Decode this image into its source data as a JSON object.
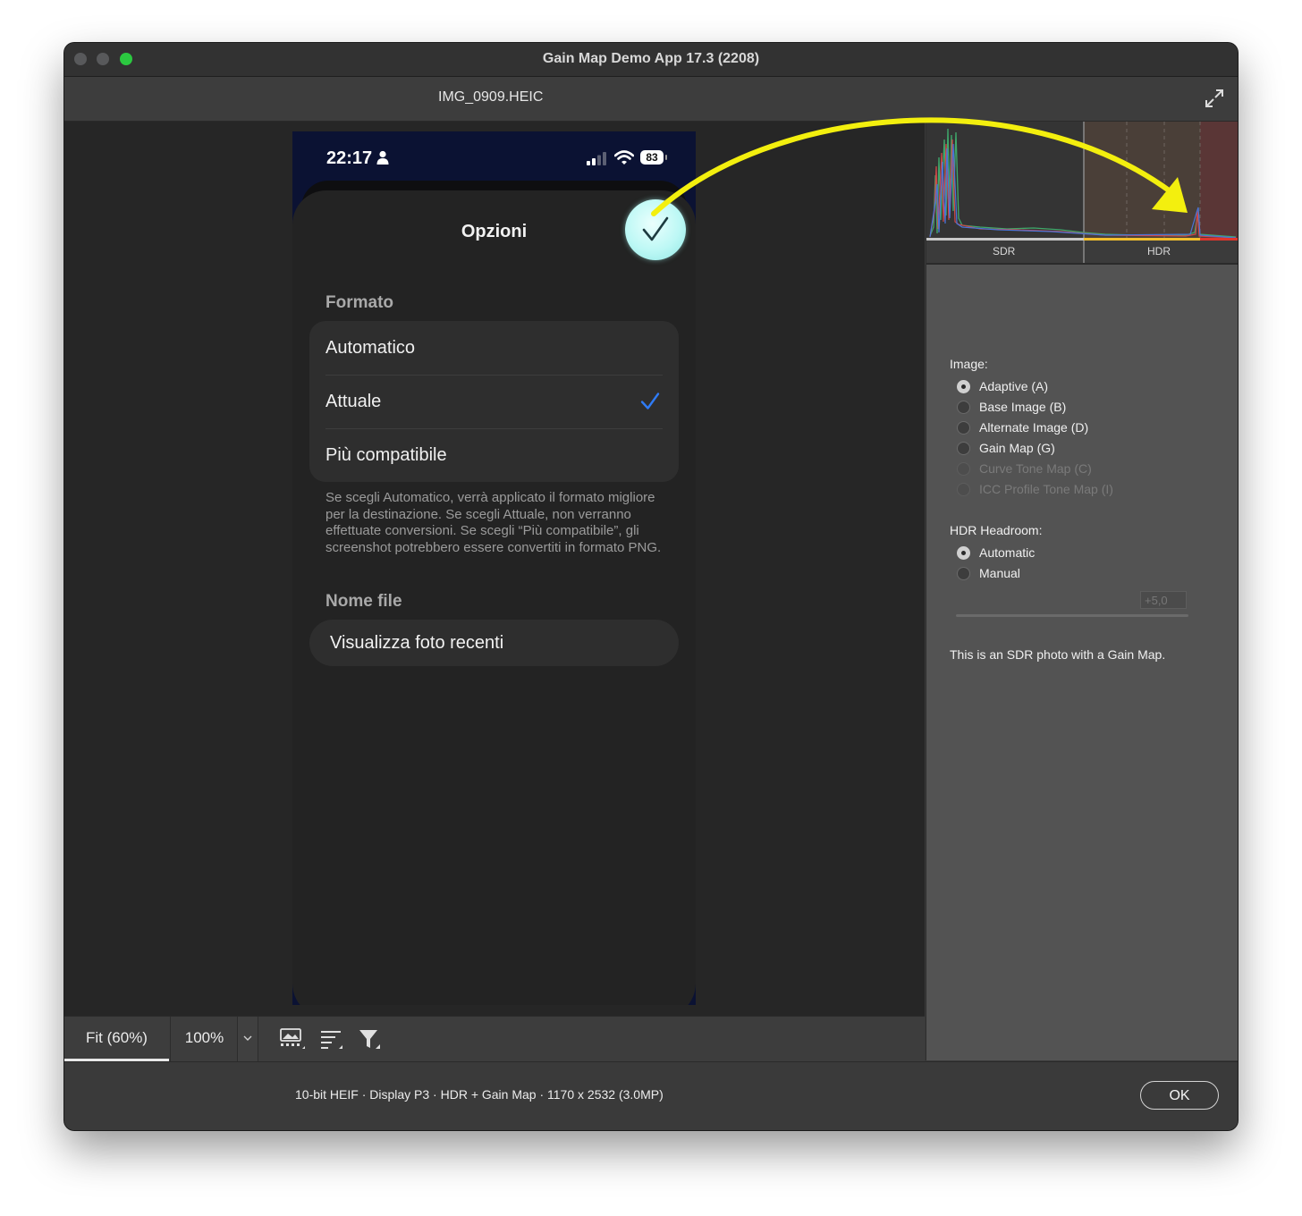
{
  "window": {
    "title": "Gain Map Demo App 17.3 (2208)",
    "file_name": "IMG_0909.HEIC"
  },
  "phone": {
    "status_time": "22:17",
    "battery_level": "83",
    "sheet_title": "Opzioni",
    "format_label": "Formato",
    "format_options": [
      {
        "label": "Automatico",
        "selected": false
      },
      {
        "label": "Attuale",
        "selected": true
      },
      {
        "label": "Più compatibile",
        "selected": false
      }
    ],
    "format_help": "Se scegli Automatico, verrà applicato il formato migliore per la destinazione. Se scegli Attuale, non verranno effettuate conversioni. Se scegli “Più compatibile”, gli screenshot potrebbero essere convertiti in formato PNG.",
    "filename_label": "Nome file",
    "recent_button": "Visualizza foto recenti"
  },
  "toolbar": {
    "fit_label": "Fit (60%)",
    "zoom_label": "100%"
  },
  "histogram": {
    "sdr_label": "SDR",
    "hdr_label": "HDR"
  },
  "panel": {
    "image_label": "Image:",
    "image_options": [
      {
        "label": "Adaptive (A)",
        "selected": true,
        "enabled": true
      },
      {
        "label": "Base Image (B)",
        "selected": false,
        "enabled": true
      },
      {
        "label": "Alternate Image (D)",
        "selected": false,
        "enabled": true
      },
      {
        "label": "Gain Map (G)",
        "selected": false,
        "enabled": true
      },
      {
        "label": "Curve Tone Map (C)",
        "selected": false,
        "enabled": false
      },
      {
        "label": "ICC Profile Tone Map (I)",
        "selected": false,
        "enabled": false
      }
    ],
    "headroom_label": "HDR Headroom:",
    "headroom_options": [
      {
        "label": "Automatic",
        "selected": true
      },
      {
        "label": "Manual",
        "selected": false
      }
    ],
    "headroom_value": "+5,0",
    "info": "This is an SDR photo with a Gain Map."
  },
  "footer": {
    "metadata": "10-bit HEIF · Display P3 · HDR + Gain Map · 1170 x 2532 (3.0MP)",
    "ok_label": "OK"
  },
  "colors": {
    "accent_check": "#2f7bf5",
    "annotation_arrow": "#f3ef0e",
    "traffic_light_green": "#2bc840"
  }
}
